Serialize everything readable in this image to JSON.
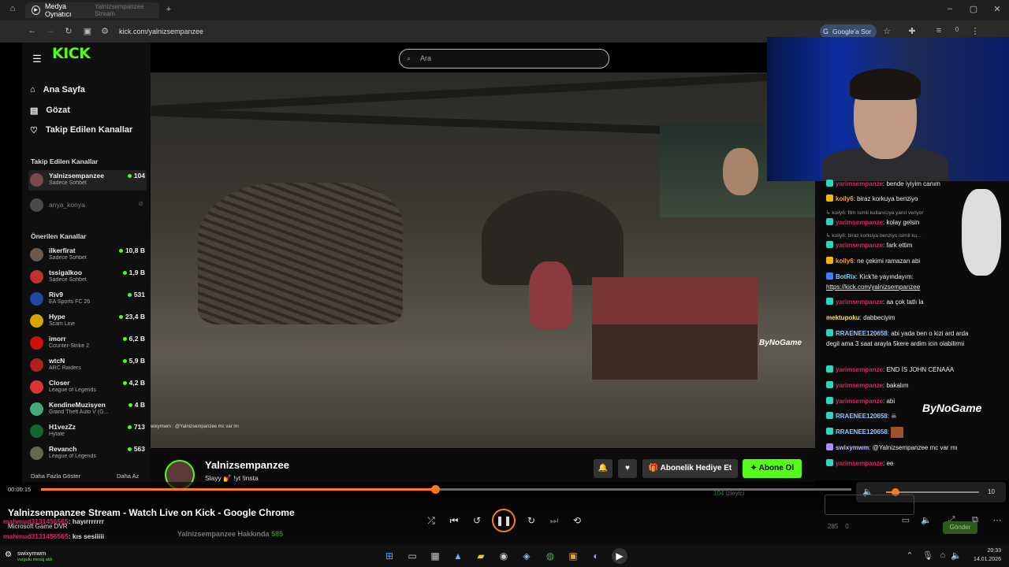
{
  "window": {
    "tab_title": "Medya Oynatıcı",
    "ghost_tab": "Yalnizsempanzee Stream"
  },
  "browser": {
    "url": "kick.com/yalnizsempanzee",
    "google_btn": "Google'a Sor",
    "ext_count": "0"
  },
  "search": {
    "placeholder": "Ara"
  },
  "sidebar": {
    "logo": "KICK",
    "nav": [
      {
        "label": "Ana Sayfa",
        "icon": "home-icon"
      },
      {
        "label": "Gözat",
        "icon": "browse-icon"
      },
      {
        "label": "Takip Edilen Kanallar",
        "icon": "heart-icon"
      }
    ],
    "followed_title": "Takip Edilen Kanallar",
    "followed": [
      {
        "name": "Yalnizsempanzee",
        "category": "Sadece Sohbet",
        "viewers": "104"
      },
      {
        "name": "anya_konya",
        "category": "",
        "viewers": ""
      }
    ],
    "recommended_title": "Önerilen Kanallar",
    "recommended": [
      {
        "name": "ilkerfirat",
        "category": "Sadece Sohbet",
        "viewers": "10,8 B"
      },
      {
        "name": "tssigalkoo",
        "category": "Sadece Sohbet",
        "viewers": "1,9 B"
      },
      {
        "name": "Riv9",
        "category": "EA Sports FC 26",
        "viewers": "531"
      },
      {
        "name": "Hype",
        "category": "Scam Line",
        "viewers": "23,4 B"
      },
      {
        "name": "imorr",
        "category": "Counter-Strike 2",
        "viewers": "6,2 B"
      },
      {
        "name": "wtcN",
        "category": "ARC Raiders",
        "viewers": "5,9 B"
      },
      {
        "name": "Closer",
        "category": "League of Legends",
        "viewers": "4,2 B"
      },
      {
        "name": "KendineMuzisyen",
        "category": "Grand Theft Auto V (G...",
        "viewers": "4 B"
      },
      {
        "name": "H1vezZz",
        "category": "Hytale",
        "viewers": "713"
      },
      {
        "name": "Revanch",
        "category": "League of Legends",
        "viewers": "563"
      }
    ],
    "show_more": "Daha Fazla Göster",
    "show_less": "Daha Az"
  },
  "video": {
    "watermark": "ByNoGame",
    "overlay_chat": "wixymwm : @Yalnizsempanzee mc var mı"
  },
  "stream": {
    "name": "Yalnizsempanzee",
    "title": "Slayy 💅 !yt !insta",
    "gift_btn": "Abonelik Hediye Et",
    "sub_btn": "Abone Ol"
  },
  "chat": [
    {
      "user": "yarimsempanze",
      "text": ": bende iyiyim canım",
      "badge": "t"
    },
    {
      "user": "koily6",
      "text": ": biraz korkuya benziyo",
      "badge": "y"
    },
    {
      "user": "",
      "text": "↳ koily6: film isimli kullanıcıya yanıt veriyor",
      "badge": ""
    },
    {
      "user": "yarimsempanze",
      "text": ": kolay gelsin",
      "badge": "t"
    },
    {
      "user": "",
      "text": "↳ koily6: biraz korkuya benziyo isimli ku...",
      "badge": ""
    },
    {
      "user": "yarimsempanze",
      "text": ": fark ettim",
      "badge": "t"
    },
    {
      "user": "koily6",
      "text": ": ne çekimi ramazan abi",
      "badge": "y"
    },
    {
      "user": "BotRix",
      "text": ": Kick'te yayındayım:",
      "badge": "t"
    },
    {
      "user": "",
      "text": "https://kick.com/yalnizsempanzee",
      "badge": ""
    },
    {
      "user": "yarimsempanze",
      "text": ": aa çok tatlı la",
      "badge": "t"
    },
    {
      "user": "mektupoku",
      "text": ": dabbeciyim",
      "badge": ""
    },
    {
      "user": "RRAENEE120658",
      "text": ": abi yada ben o kizi ard arda degil ama 3 saat arayla 5kere ardim icin olabilirmi",
      "badge": "t"
    },
    {
      "user": "yarimsempanze",
      "text": ": END İS JOHN CENAAA",
      "badge": "t"
    },
    {
      "user": "yarimsempanze",
      "text": ": bakalım",
      "badge": "t"
    },
    {
      "user": "yarimsempanze",
      "text": ": abi",
      "badge": "t"
    },
    {
      "user": "RRAENEE120658",
      "text": ":",
      "badge": "t"
    },
    {
      "user": "RRAENEE120658",
      "text": ":",
      "badge": "t"
    },
    {
      "user": "swixymwm",
      "text": ": @Yalnizsempanzee mc var mı",
      "badge": ""
    },
    {
      "user": "yarimsempanze",
      "text": ": ee",
      "badge": "t"
    }
  ],
  "chat_watermark": "ByNoGame",
  "player": {
    "time": "00:00:15",
    "progress": 0.486,
    "title": "Yalnizsempanzee Stream - Watch Live on Kick - Google Chrome",
    "volume_label": "10",
    "volume": 0.1,
    "dvr_label": "Microsoft Game DVR",
    "ghost_lines": [
      {
        "user": "mahmud3131456565",
        "text": ": hayırrrrrrr"
      },
      {
        "user": "mahmud3131456565",
        "text": ": kıs sesiiiii"
      }
    ],
    "about": "Yalnizsempanzee Hakkında",
    "about_count": "585",
    "viewers_ghost": "104",
    "viewers_ghost_label": "izleyici",
    "chat_count": "285",
    "chat_zero": "0",
    "send_btn": "Gönder"
  },
  "notif": {
    "user": "swixymwm",
    "sub": "vurgulu mesaj aldı"
  },
  "clock": {
    "time": "20:33",
    "date": "14.01.2026"
  }
}
